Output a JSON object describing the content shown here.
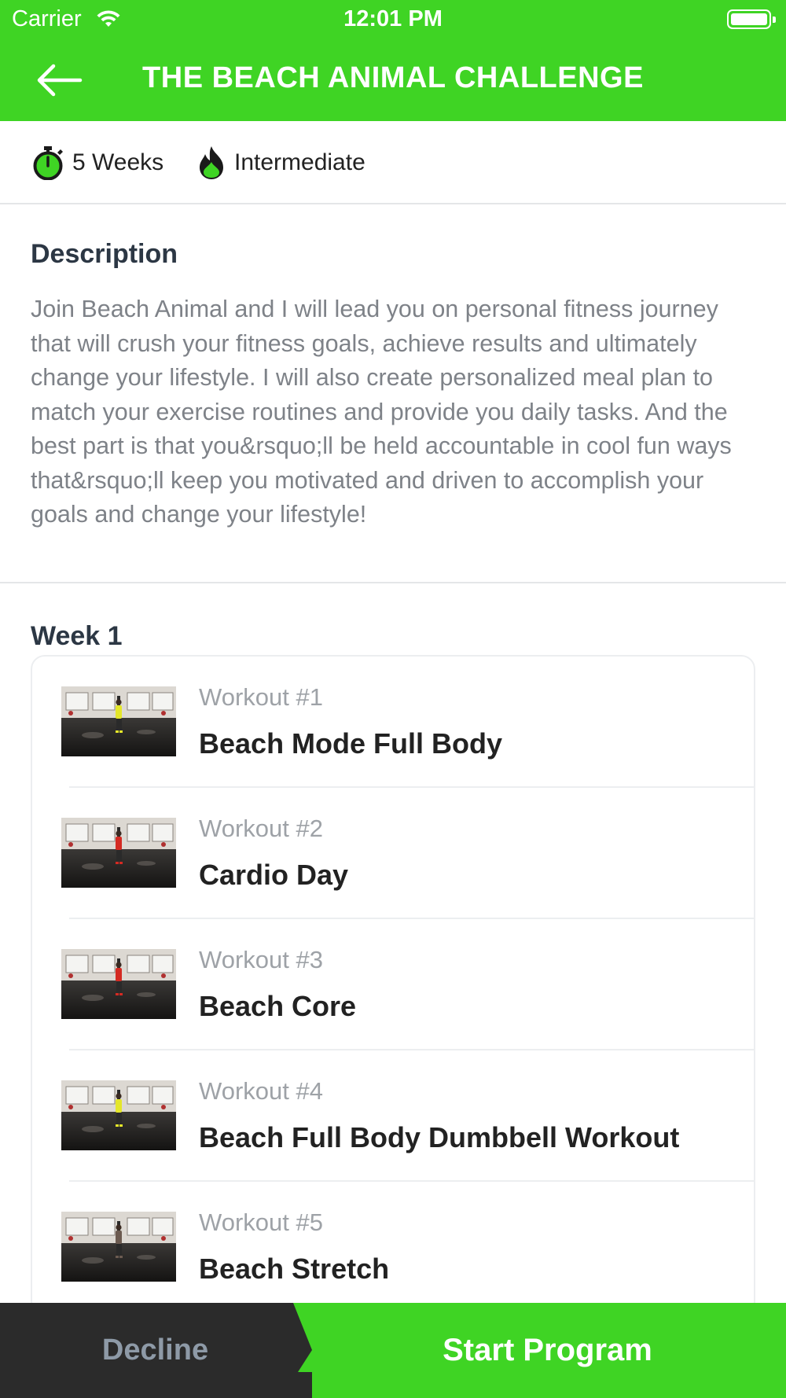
{
  "status_bar": {
    "carrier": "Carrier",
    "time": "12:01 PM"
  },
  "header": {
    "title": "THE BEACH ANIMAL CHALLENGE",
    "back_icon": "arrow-left-icon",
    "background_color": "#3fd424"
  },
  "meta": {
    "duration": "5 Weeks",
    "duration_icon": "stopwatch-icon",
    "level": "Intermediate",
    "level_icon": "flame-icon"
  },
  "description": {
    "heading": "Description",
    "text": "Join Beach Animal and I will lead you on personal fitness journey that will crush your fitness goals, achieve results and ultimately change your lifestyle. I will also create personalized meal plan to match your exercise routines and provide you daily tasks. And the best part is that you&rsquo;ll be held accountable in cool fun ways that&rsquo;ll keep you motivated and driven to accomplish your goals and change your lifestyle!"
  },
  "week": {
    "label": "Week 1",
    "workouts": [
      {
        "number": "Workout #1",
        "name": "Beach Mode Full Body",
        "outfit_color": "#e4e62a"
      },
      {
        "number": "Workout #2",
        "name": "Cardio Day",
        "outfit_color": "#d42a22"
      },
      {
        "number": "Workout #3",
        "name": "Beach Core",
        "outfit_color": "#d42a22"
      },
      {
        "number": "Workout #4",
        "name": "Beach Full Body Dumbbell Workout",
        "outfit_color": "#e4e62a"
      },
      {
        "number": "Workout #5",
        "name": "Beach Stretch",
        "outfit_color": "#6b5a50"
      }
    ]
  },
  "actions": {
    "decline": "Decline",
    "start": "Start Program",
    "accent_color": "#3fd424",
    "dark_color": "#2b2b2b"
  }
}
